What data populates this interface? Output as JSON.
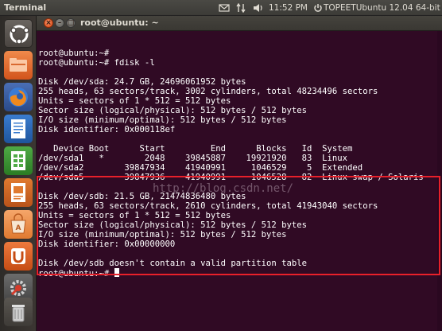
{
  "top_panel": {
    "app_name": "Terminal",
    "time": "11:52 PM",
    "user": "TOPEETUbuntu 12.04 64-bit",
    "icons": [
      "mail-icon",
      "network-arrows-icon",
      "volume-icon",
      "power-icon"
    ]
  },
  "launcher": {
    "items": [
      {
        "name": "dash-home",
        "icon": "ubuntu-logo-icon"
      },
      {
        "name": "home-folder",
        "icon": "folder-icon"
      },
      {
        "name": "firefox",
        "icon": "firefox-icon"
      },
      {
        "name": "libreoffice-writer",
        "icon": "writer-icon"
      },
      {
        "name": "libreoffice-calc",
        "icon": "calc-icon"
      },
      {
        "name": "libreoffice-impress",
        "icon": "impress-icon"
      },
      {
        "name": "ubuntu-software-center",
        "icon": "software-center-icon"
      },
      {
        "name": "ubuntu-one",
        "icon": "ubuntu-one-icon"
      },
      {
        "name": "system-settings",
        "icon": "settings-icon"
      },
      {
        "name": "trash",
        "icon": "trash-icon"
      }
    ]
  },
  "window": {
    "title": "root@ubuntu: ~",
    "close_glyph": "×",
    "min_glyph": "–",
    "max_glyph": "□"
  },
  "terminal": {
    "lines": [
      "root@ubuntu:~#",
      "root@ubuntu:~# fdisk -l",
      "",
      "Disk /dev/sda: 24.7 GB, 24696061952 bytes",
      "255 heads, 63 sectors/track, 3002 cylinders, total 48234496 sectors",
      "Units = sectors of 1 * 512 = 512 bytes",
      "Sector size (logical/physical): 512 bytes / 512 bytes",
      "I/O size (minimum/optimal): 512 bytes / 512 bytes",
      "Disk identifier: 0x000118ef",
      "",
      "   Device Boot      Start         End      Blocks   Id  System",
      "/dev/sda1   *        2048    39845887    19921920   83  Linux",
      "/dev/sda2        39847934    41940991     1046529    5  Extended",
      "/dev/sda5        39847936    41940991     1046528   82  Linux swap / Solaris",
      "",
      "Disk /dev/sdb: 21.5 GB, 21474836480 bytes",
      "255 heads, 63 sectors/track, 2610 cylinders, total 41943040 sectors",
      "Units = sectors of 1 * 512 = 512 bytes",
      "Sector size (logical/physical): 512 bytes / 512 bytes",
      "I/O size (minimum/optimal): 512 bytes / 512 bytes",
      "Disk identifier: 0x00000000",
      "",
      "Disk /dev/sdb doesn't contain a valid partition table",
      "root@ubuntu:~# "
    ],
    "watermark": "http://blog.csdn.net/"
  },
  "colors": {
    "terminal_bg": "#300a24",
    "text": "#ffffff",
    "highlight": "#e8202a",
    "close_button": "#df4b16"
  }
}
